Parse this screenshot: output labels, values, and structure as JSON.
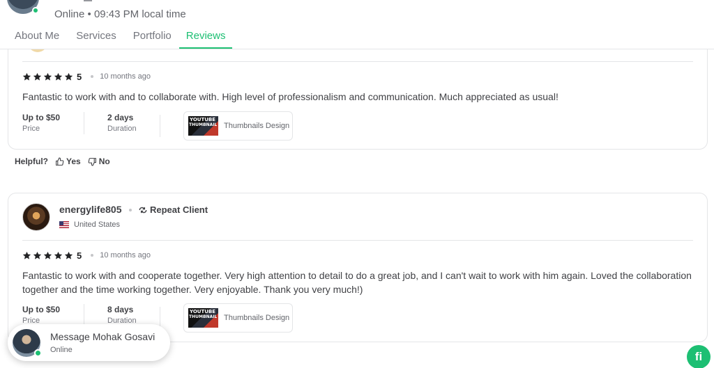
{
  "header": {
    "status": "Online • 09:43 PM local time",
    "tabs": [
      {
        "label": "About Me",
        "active": false
      },
      {
        "label": "Services",
        "active": false
      },
      {
        "label": "Portfolio",
        "active": false
      },
      {
        "label": "Reviews",
        "active": true
      }
    ]
  },
  "reviews": [
    {
      "rating": "5",
      "stars": 5,
      "time_ago": "10 months ago",
      "text": "Fantastic to work with and to collaborate with. High level of professionalism and communication. Much appreciated as usual!",
      "price_value": "Up to $50",
      "price_label": "Price",
      "duration_value": "2 days",
      "duration_label": "Duration",
      "gig_title": "Thumbnails Design"
    },
    {
      "reviewer": "energylife805",
      "badge": "Repeat Client",
      "country": "United States",
      "rating": "5",
      "stars": 5,
      "time_ago": "10 months ago",
      "text": "Fantastic to work with and cooperate together. Very high attention to detail to do a great job, and I can't wait to work with him again. Loved the collaboration together and the time working together. Very enjoyable. Thank you very much!)",
      "price_value": "Up to $50",
      "price_label": "Price",
      "duration_value": "8 days",
      "duration_label": "Duration",
      "gig_title": "Thumbnails Design"
    }
  ],
  "helpful": {
    "label": "Helpful?",
    "yes": "Yes",
    "no": "No"
  },
  "chat": {
    "title": "Message Mohak Gosavi",
    "status": "Online"
  },
  "brand": {
    "badge": "fi",
    "accent_color": "#1dbf73",
    "star_color": "#222325"
  }
}
